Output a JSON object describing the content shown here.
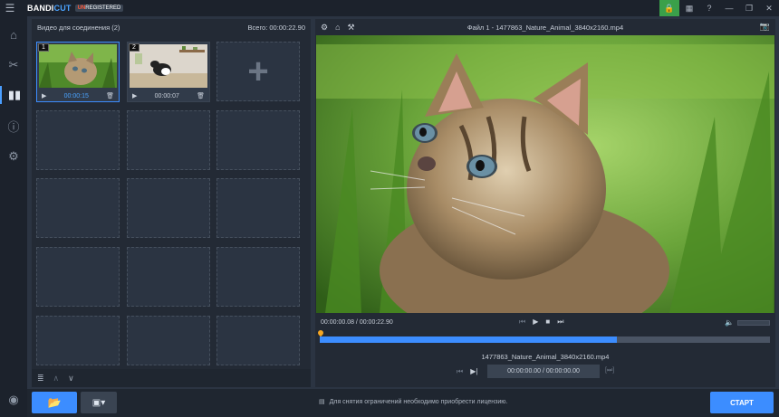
{
  "app": {
    "brand_a": "BANDI",
    "brand_b": "CUT",
    "badge_un": "UN",
    "badge_rest": "REGISTERED"
  },
  "left_panel": {
    "title": "Видео для соединения (2)",
    "total": "Всего: 00:00:22.90",
    "clips": [
      {
        "num": "1",
        "duration": "00:00:15"
      },
      {
        "num": "2",
        "duration": "00:00:07"
      }
    ]
  },
  "right_panel": {
    "file_title": "Файл 1 - 1477863_Nature_Animal_3840x2160.mp4",
    "time_readout": "00:00:00.08 / 00:00:22.90",
    "progress": 0.66,
    "file_name": "1477863_Nature_Animal_3840x2160.mp4",
    "range": "00:00:00.00 / 00:00:00.00"
  },
  "bottom": {
    "notice": "Для снятия ограничений необходимо приобрести лицензию.",
    "start": "СТАРТ"
  },
  "colors": {
    "accent": "#3c8dff",
    "marker": "#f5a623",
    "lock": "#3aa04a"
  }
}
